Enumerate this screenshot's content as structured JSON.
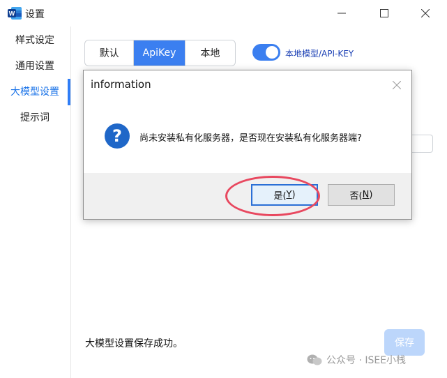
{
  "window": {
    "title": "设置"
  },
  "sidebar": {
    "items": [
      {
        "label": "样式设定"
      },
      {
        "label": "通用设置"
      },
      {
        "label": "大模型设置"
      },
      {
        "label": "提示词"
      }
    ],
    "active_index": 2
  },
  "tabs": [
    {
      "label": "默认"
    },
    {
      "label": "ApiKey"
    },
    {
      "label": "本地"
    }
  ],
  "selected_tab": "ApiKey",
  "toggle": {
    "label": "本地模型/API-KEY",
    "on": true
  },
  "status": {
    "text": "大模型设置保存成功。"
  },
  "actions": {
    "save_label": "保存"
  },
  "dialog": {
    "title": "information",
    "message": "尚未安装私有化服务器，是否现在安装私有化服务器端?",
    "yes_text": "是(",
    "yes_key": "Y",
    "yes_close": ")",
    "no_text": "否(",
    "no_key": "N",
    "no_close": ")"
  },
  "watermark": {
    "text": "公众号 · ISEE小栈"
  },
  "colors": {
    "accent": "#3b7ff0",
    "highlight_ring": "#e8485f",
    "dialog_icon": "#1f67c8"
  }
}
